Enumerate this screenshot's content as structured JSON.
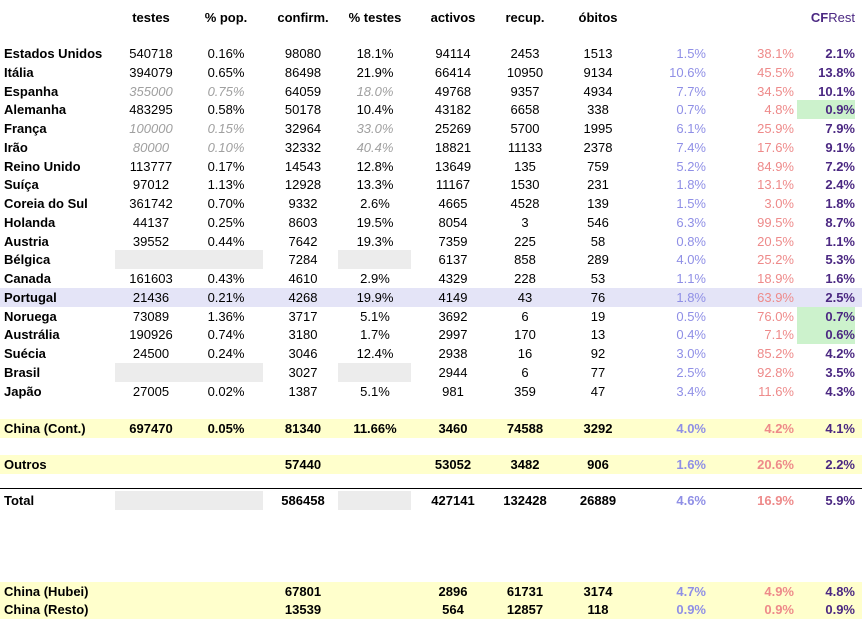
{
  "headers": {
    "testes": "testes",
    "pop": "% pop.",
    "confirm": "confirm.",
    "pct_testes": "% testes",
    "activos": "activos",
    "recup": "recup.",
    "obitos": "óbitos",
    "cfr_a": "CF",
    "cfr_b": "Rest"
  },
  "rows": [
    {
      "name": "Estados Unidos",
      "testes": "540718",
      "pop": "0.16%",
      "confirm": "98080",
      "pct_testes": "18.1%",
      "activos": "94114",
      "recup": "2453",
      "obitos": "1513",
      "b1": "1.5%",
      "b2": "38.1%",
      "cfr": "2.1%"
    },
    {
      "name": "Itália",
      "testes": "394079",
      "pop": "0.65%",
      "confirm": "86498",
      "pct_testes": "21.9%",
      "activos": "66414",
      "recup": "10950",
      "obitos": "9134",
      "b1": "10.6%",
      "b2": "45.5%",
      "cfr": "13.8%"
    },
    {
      "name": "Espanha",
      "testes": "355000",
      "pop": "0.75%",
      "confirm": "64059",
      "pct_testes": "18.0%",
      "activos": "49768",
      "recup": "9357",
      "obitos": "4934",
      "b1": "7.7%",
      "b2": "34.5%",
      "cfr": "10.1%"
    },
    {
      "name": "Alemanha",
      "testes": "483295",
      "pop": "0.58%",
      "confirm": "50178",
      "pct_testes": "10.4%",
      "activos": "43182",
      "recup": "6658",
      "obitos": "338",
      "b1": "0.7%",
      "b2": "4.8%",
      "cfr": "0.9%"
    },
    {
      "name": "França",
      "testes": "100000",
      "pop": "0.15%",
      "confirm": "32964",
      "pct_testes": "33.0%",
      "activos": "25269",
      "recup": "5700",
      "obitos": "1995",
      "b1": "6.1%",
      "b2": "25.9%",
      "cfr": "7.9%"
    },
    {
      "name": "Irão",
      "testes": "80000",
      "pop": "0.10%",
      "confirm": "32332",
      "pct_testes": "40.4%",
      "activos": "18821",
      "recup": "11133",
      "obitos": "2378",
      "b1": "7.4%",
      "b2": "17.6%",
      "cfr": "9.1%"
    },
    {
      "name": "Reino Unido",
      "testes": "113777",
      "pop": "0.17%",
      "confirm": "14543",
      "pct_testes": "12.8%",
      "activos": "13649",
      "recup": "135",
      "obitos": "759",
      "b1": "5.2%",
      "b2": "84.9%",
      "cfr": "7.2%"
    },
    {
      "name": "Suíça",
      "testes": "97012",
      "pop": "1.13%",
      "confirm": "12928",
      "pct_testes": "13.3%",
      "activos": "11167",
      "recup": "1530",
      "obitos": "231",
      "b1": "1.8%",
      "b2": "13.1%",
      "cfr": "2.4%"
    },
    {
      "name": "Coreia do Sul",
      "testes": "361742",
      "pop": "0.70%",
      "confirm": "9332",
      "pct_testes": "2.6%",
      "activos": "4665",
      "recup": "4528",
      "obitos": "139",
      "b1": "1.5%",
      "b2": "3.0%",
      "cfr": "1.8%"
    },
    {
      "name": "Holanda",
      "testes": "44137",
      "pop": "0.25%",
      "confirm": "8603",
      "pct_testes": "19.5%",
      "activos": "8054",
      "recup": "3",
      "obitos": "546",
      "b1": "6.3%",
      "b2": "99.5%",
      "cfr": "8.7%"
    },
    {
      "name": "Austria",
      "testes": "39552",
      "pop": "0.44%",
      "confirm": "7642",
      "pct_testes": "19.3%",
      "activos": "7359",
      "recup": "225",
      "obitos": "58",
      "b1": "0.8%",
      "b2": "20.5%",
      "cfr": "1.1%"
    },
    {
      "name": "Bélgica",
      "testes": "",
      "pop": "",
      "confirm": "7284",
      "pct_testes": "",
      "activos": "6137",
      "recup": "858",
      "obitos": "289",
      "b1": "4.0%",
      "b2": "25.2%",
      "cfr": "5.3%"
    },
    {
      "name": "Canada",
      "testes": "161603",
      "pop": "0.43%",
      "confirm": "4610",
      "pct_testes": "2.9%",
      "activos": "4329",
      "recup": "228",
      "obitos": "53",
      "b1": "1.1%",
      "b2": "18.9%",
      "cfr": "1.6%"
    },
    {
      "name": "Portugal",
      "testes": "21436",
      "pop": "0.21%",
      "confirm": "4268",
      "pct_testes": "19.9%",
      "activos": "4149",
      "recup": "43",
      "obitos": "76",
      "b1": "1.8%",
      "b2": "63.9%",
      "cfr": "2.5%"
    },
    {
      "name": "Noruega",
      "testes": "73089",
      "pop": "1.36%",
      "confirm": "3717",
      "pct_testes": "5.1%",
      "activos": "3692",
      "recup": "6",
      "obitos": "19",
      "b1": "0.5%",
      "b2": "76.0%",
      "cfr": "0.7%"
    },
    {
      "name": "Austrália",
      "testes": "190926",
      "pop": "0.74%",
      "confirm": "3180",
      "pct_testes": "1.7%",
      "activos": "2997",
      "recup": "170",
      "obitos": "13",
      "b1": "0.4%",
      "b2": "7.1%",
      "cfr": "0.6%"
    },
    {
      "name": "Suécia",
      "testes": "24500",
      "pop": "0.24%",
      "confirm": "3046",
      "pct_testes": "12.4%",
      "activos": "2938",
      "recup": "16",
      "obitos": "92",
      "b1": "3.0%",
      "b2": "85.2%",
      "cfr": "4.2%"
    },
    {
      "name": "Brasil",
      "testes": "",
      "pop": "",
      "confirm": "3027",
      "pct_testes": "",
      "activos": "2944",
      "recup": "6",
      "obitos": "77",
      "b1": "2.5%",
      "b2": "92.8%",
      "cfr": "3.5%"
    },
    {
      "name": "Japão",
      "testes": "27005",
      "pop": "0.02%",
      "confirm": "1387",
      "pct_testes": "5.1%",
      "activos": "981",
      "recup": "359",
      "obitos": "47",
      "b1": "3.4%",
      "b2": "11.6%",
      "cfr": "4.3%"
    }
  ],
  "china": {
    "name": "China (Cont.)",
    "testes": "697470",
    "pop": "0.05%",
    "confirm": "81340",
    "pct_testes": "11.66%",
    "activos": "3460",
    "recup": "74588",
    "obitos": "3292",
    "b1": "4.0%",
    "b2": "4.2%",
    "cfr": "4.1%"
  },
  "outros": {
    "name": "Outros",
    "confirm": "57440",
    "activos": "53052",
    "recup": "3482",
    "obitos": "906",
    "b1": "1.6%",
    "b2": "20.6%",
    "cfr": "2.2%"
  },
  "total": {
    "name": "Total",
    "confirm": "586458",
    "activos": "427141",
    "recup": "132428",
    "obitos": "26889",
    "b1": "4.6%",
    "b2": "16.9%",
    "cfr": "5.9%"
  },
  "hubei": {
    "name": "China (Hubei)",
    "confirm": "67801",
    "activos": "2896",
    "recup": "61731",
    "obitos": "3174",
    "b1": "4.7%",
    "b2": "4.9%",
    "cfr": "4.8%"
  },
  "resto": {
    "name": "China (Resto)",
    "confirm": "13539",
    "activos": "564",
    "recup": "12857",
    "obitos": "118",
    "b1": "0.9%",
    "b2": "0.9%",
    "cfr": "0.9%"
  }
}
